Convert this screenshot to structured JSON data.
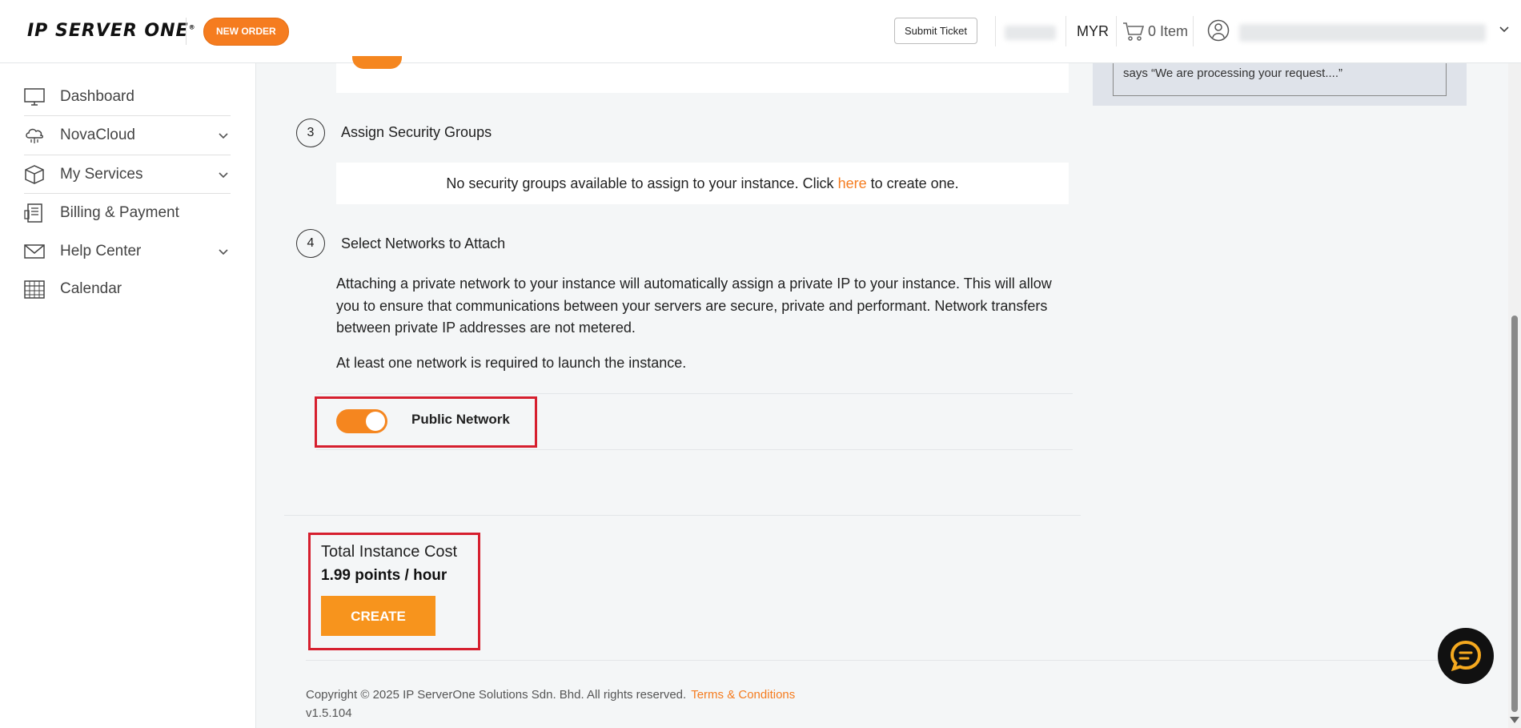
{
  "header": {
    "logo": "IP SERVER ONE",
    "new_order": "NEW ORDER",
    "submit_ticket": "Submit Ticket",
    "currency": "MYR",
    "cart_count": "0 Item"
  },
  "sidebar": {
    "items": [
      {
        "label": "Dashboard",
        "icon": "monitor-icon"
      },
      {
        "label": "NovaCloud",
        "icon": "cloud-icon"
      },
      {
        "label": "My Services",
        "icon": "box-icon"
      },
      {
        "label": "Billing & Payment",
        "icon": "receipt-icon"
      },
      {
        "label": "Help Center",
        "icon": "envelope-icon"
      },
      {
        "label": "Calendar",
        "icon": "calendar-icon"
      }
    ]
  },
  "right_panel": {
    "text": "says “We are processing your request....”"
  },
  "steps": [
    {
      "number": "3",
      "title": "Assign Security Groups"
    },
    {
      "number": "4",
      "title": "Select Networks to Attach"
    }
  ],
  "security_groups": {
    "prefix": "No security groups available to assign to your instance. Click ",
    "link": "here",
    "suffix": " to create one."
  },
  "networks": {
    "description": "Attaching a private network to your instance will automatically assign a private IP to your instance. This will allow you to ensure that communications between your servers are secure, private and performant. Network transfers between private IP addresses are not metered.",
    "requirement": "At least one network is required to launch the instance.",
    "public_network_label": "Public Network",
    "public_network_enabled": true
  },
  "cost": {
    "title": "Total Instance Cost",
    "value": "1.99 points / hour",
    "create_label": "CREATE"
  },
  "footer": {
    "copyright": "Copyright © 2025 IP ServerOne Solutions Sdn. Bhd. All rights reserved.",
    "terms": "Terms & Conditions",
    "version": "v1.5.104"
  },
  "colors": {
    "accent": "#f57c1f",
    "highlight": "#d61f2e"
  }
}
